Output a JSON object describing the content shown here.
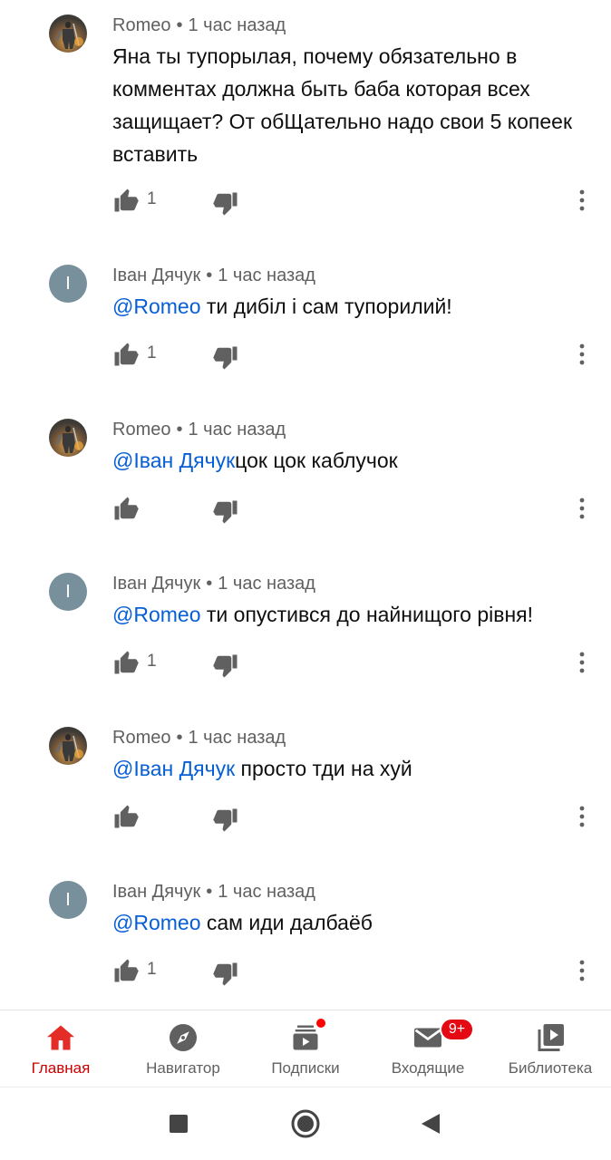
{
  "comments": [
    {
      "author": "Romeo",
      "time": "1 час назад",
      "mention": "",
      "text": "Яна ты тупорылая, почему обязательно в комментах должна быть баба которая всех защищает? От обЩательно надо свои 5 копеек вставить",
      "likes": "1",
      "avatar_type": "image"
    },
    {
      "author": "Іван Дячук",
      "time": "1 час назад",
      "mention": "@Romeo",
      "text": " ти дибіл і сам тупорилий!",
      "likes": "1",
      "avatar_type": "letter",
      "avatar_letter": "І"
    },
    {
      "author": "Romeo",
      "time": "1 час назад",
      "mention": "@Іван Дячук",
      "text": "цок цок каблучок",
      "likes": "",
      "avatar_type": "image"
    },
    {
      "author": "Іван Дячук",
      "time": "1 час назад",
      "mention": "@Romeo",
      "text": " ти опустився до найнищого рівня!",
      "likes": "1",
      "avatar_type": "letter",
      "avatar_letter": "І"
    },
    {
      "author": "Romeo",
      "time": "1 час назад",
      "mention": "@Іван Дячук",
      "text": " просто тди на хуй",
      "likes": "",
      "avatar_type": "image"
    },
    {
      "author": "Іван Дячук",
      "time": "1 час назад",
      "mention": "@Romeo",
      "text": " сам иди далбаёб",
      "likes": "1",
      "avatar_type": "letter",
      "avatar_letter": "І"
    }
  ],
  "meta_separator": "•",
  "nav": {
    "items": [
      {
        "label": "Главная",
        "icon": "home-icon",
        "active": true
      },
      {
        "label": "Навигатор",
        "icon": "explore-icon",
        "active": false
      },
      {
        "label": "Подписки",
        "icon": "subscriptions-icon",
        "active": false,
        "badge_dot": true
      },
      {
        "label": "Входящие",
        "icon": "inbox-icon",
        "active": false,
        "badge": "9+"
      },
      {
        "label": "Библиотека",
        "icon": "library-icon",
        "active": false
      }
    ]
  },
  "colors": {
    "accent": "#cc0000",
    "mention": "#065fd4",
    "secondary_text": "#606060",
    "icon": "#606060",
    "avatar_letter_bg": "#78909c"
  }
}
